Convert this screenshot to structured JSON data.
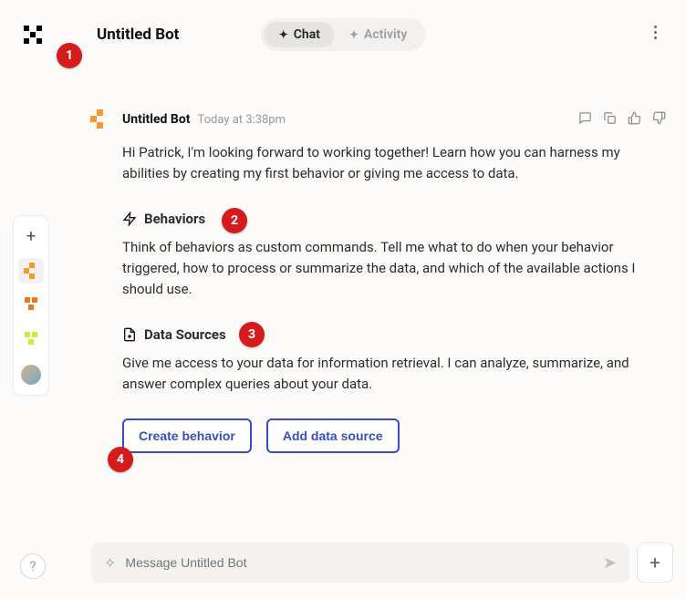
{
  "header": {
    "title": "Untitled Bot",
    "tabs": {
      "chat": "Chat",
      "activity": "Activity"
    }
  },
  "message": {
    "author": "Untitled Bot",
    "timestamp": "Today at 3:38pm",
    "intro": "Hi Patrick, I'm looking forward to working together! Learn how you can harness my abilities by creating my first behavior or giving me access to data.",
    "behaviors": {
      "heading": "Behaviors",
      "text": "Think of behaviors as custom commands. Tell me what to do when your behavior triggered, how to process or summarize the data, and which of the available actions I should use."
    },
    "datasources": {
      "heading": "Data Sources",
      "text": "Give me access to your data for information retrieval. I can analyze, summarize, and answer complex queries about your data."
    },
    "buttons": {
      "create": "Create behavior",
      "add": "Add data source"
    }
  },
  "composer": {
    "placeholder": "Message Untitled Bot"
  },
  "badges": [
    "1",
    "2",
    "3",
    "4"
  ]
}
